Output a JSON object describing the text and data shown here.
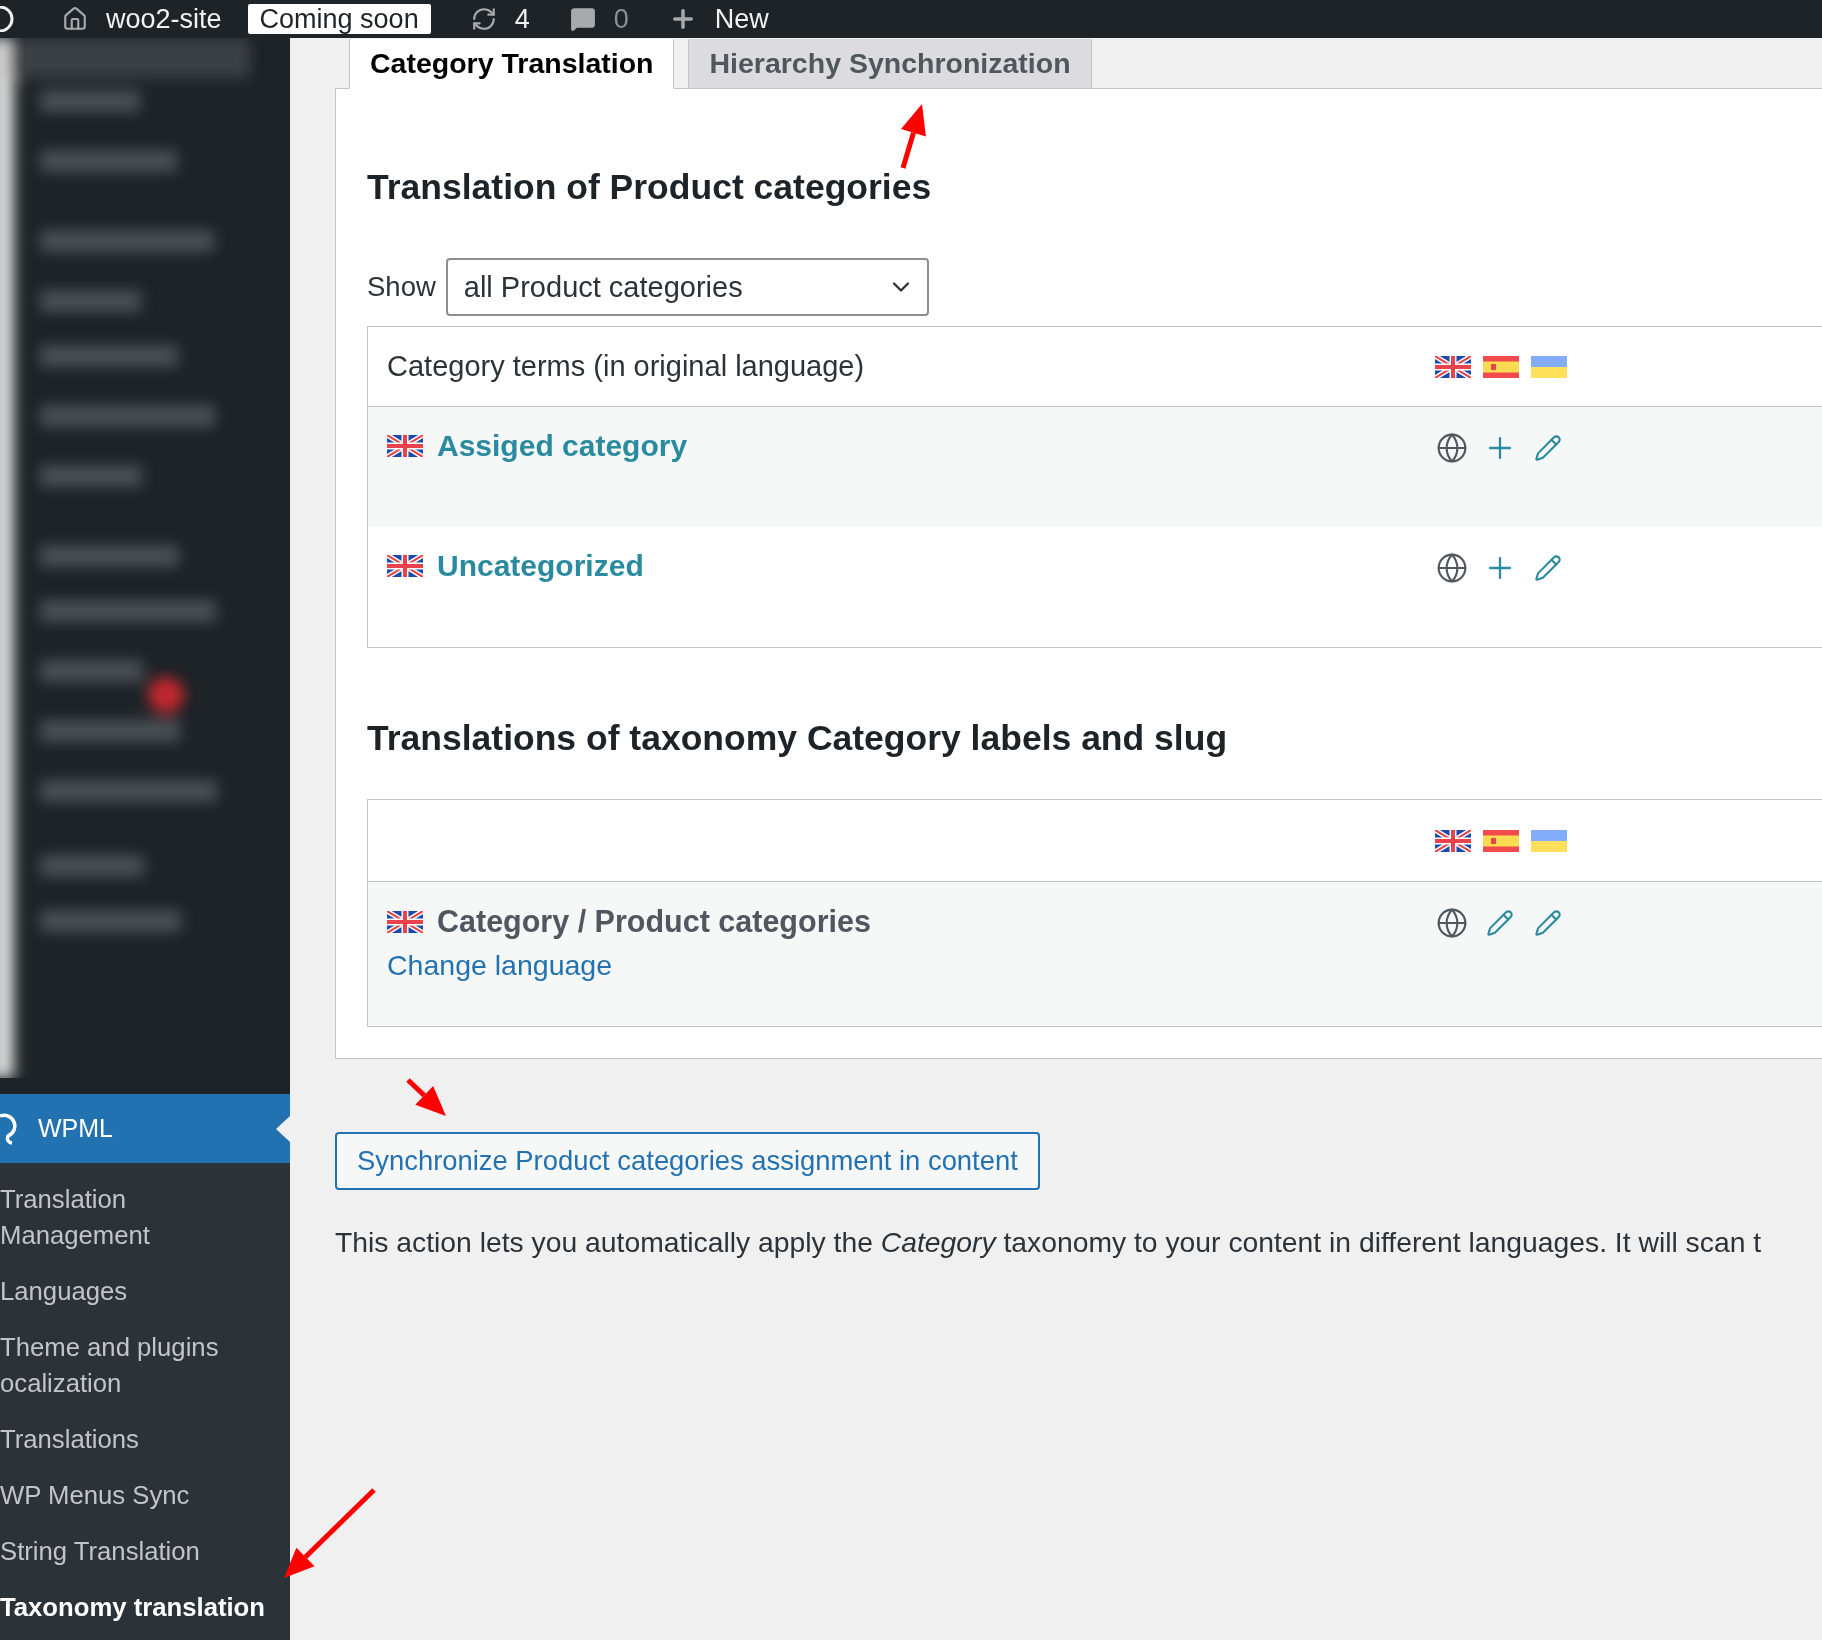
{
  "admin_bar": {
    "site": "woo2-site",
    "badge": "Coming soon",
    "updates": "4",
    "comments": "0",
    "new": "New"
  },
  "sidebar": {
    "menu": {
      "label": "WPML",
      "selected": true
    },
    "items": [
      {
        "lines": [
          "Translation",
          "Management"
        ],
        "selected": false
      },
      {
        "lines": [
          "Languages"
        ],
        "selected": false
      },
      {
        "lines": [
          "Theme and plugins",
          "ocalization"
        ],
        "selected": false
      },
      {
        "lines": [
          "Translations"
        ],
        "selected": false
      },
      {
        "lines": [
          "WP Menus Sync"
        ],
        "selected": false
      },
      {
        "lines": [
          "String Translation"
        ],
        "selected": false
      },
      {
        "lines": [
          "Taxonomy translation"
        ],
        "selected": true
      }
    ]
  },
  "tabs": [
    {
      "label": "Category Translation",
      "selected": true
    },
    {
      "label": "Hierarchy Synchronization",
      "selected": false
    }
  ],
  "heading": "Translation of Product categories",
  "filter": {
    "label": "Show",
    "value": "all Product categories"
  },
  "terms_table": {
    "header": "Category terms (in original language)",
    "rows": [
      {
        "name": "Assiged category",
        "kind": "term"
      },
      {
        "name": "Uncategorized",
        "kind": "term"
      }
    ]
  },
  "labels_heading": "Translations of taxonomy Category labels and slug",
  "labels_table": {
    "rows": [
      {
        "name": "Category / Product categories",
        "link": "Change language",
        "kind": "label"
      }
    ]
  },
  "sync_button": "Synchronize Product categories assignment in content",
  "description": "This action lets you automatically apply the *Category* taxonomy to your content in different languages. It will scan t"
}
